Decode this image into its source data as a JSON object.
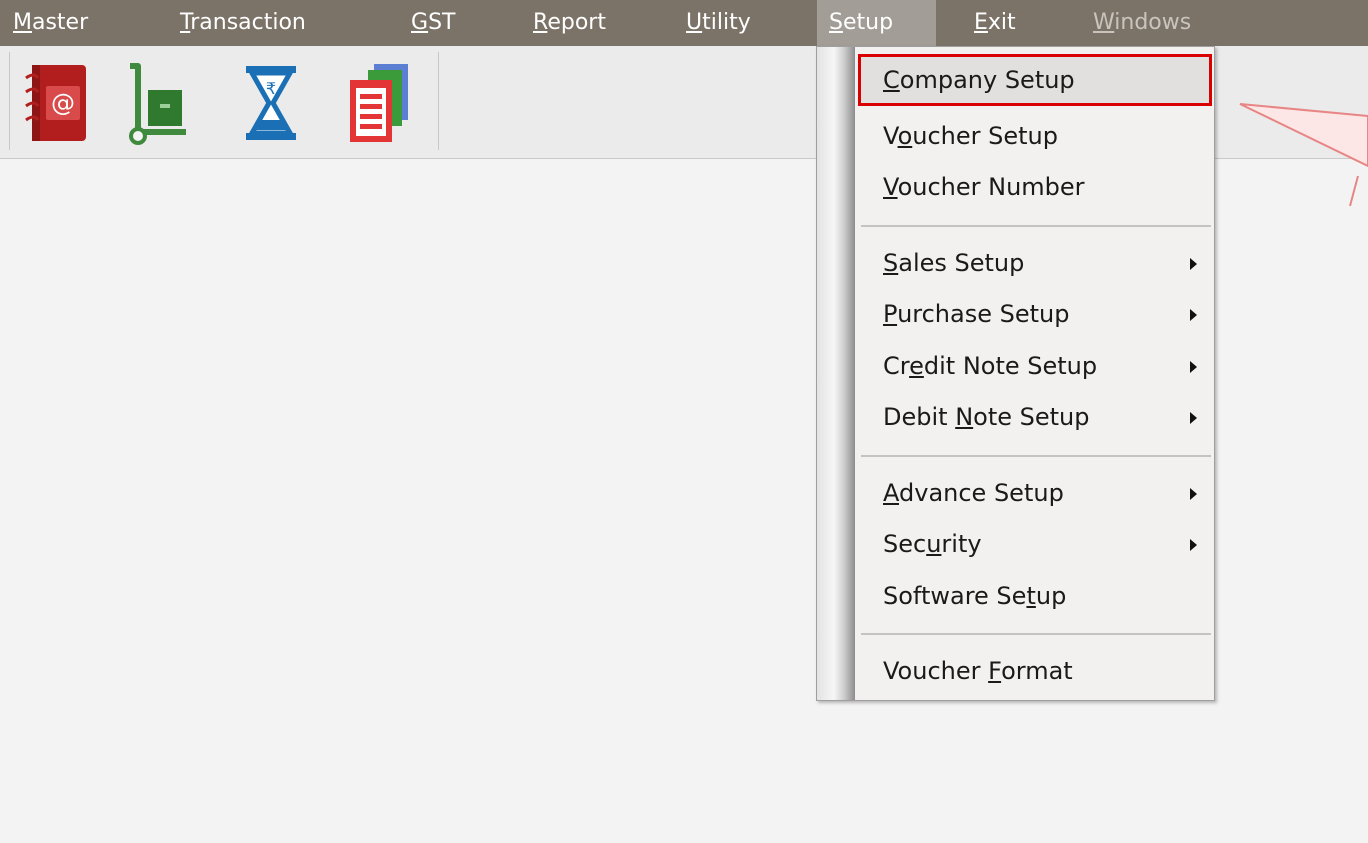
{
  "menubar": {
    "items": [
      {
        "pre": "",
        "acc": "M",
        "post": "aster"
      },
      {
        "pre": "",
        "acc": "T",
        "post": "ransaction"
      },
      {
        "pre": "",
        "acc": "G",
        "post": "ST"
      },
      {
        "pre": "",
        "acc": "R",
        "post": "eport"
      },
      {
        "pre": "",
        "acc": "U",
        "post": "tility"
      },
      {
        "pre": "",
        "acc": "S",
        "post": "etup"
      },
      {
        "pre": "",
        "acc": "E",
        "post": "xit"
      },
      {
        "pre": "",
        "acc": "W",
        "post": "indows"
      }
    ],
    "active_item": "Setup",
    "disabled_item": "Windows"
  },
  "toolbar": {
    "icons": [
      "address-book-icon",
      "hand-truck-icon",
      "hourglass-rupee-icon",
      "documents-stack-icon"
    ]
  },
  "setup_menu": {
    "items": [
      {
        "pre": "",
        "acc": "C",
        "post": "ompany Setup",
        "submenu": false,
        "highlighted": true
      },
      {
        "pre": "V",
        "acc": "o",
        "post": "ucher Setup",
        "submenu": false
      },
      {
        "pre": "",
        "acc": "V",
        "post": "oucher Number",
        "submenu": false
      },
      {
        "pre": "",
        "acc": "S",
        "post": "ales Setup",
        "submenu": true
      },
      {
        "pre": "",
        "acc": "P",
        "post": "urchase Setup",
        "submenu": true
      },
      {
        "pre": "Cr",
        "acc": "e",
        "post": "dit Note Setup",
        "submenu": true
      },
      {
        "pre": "Debit ",
        "acc": "N",
        "post": "ote Setup",
        "submenu": true
      },
      {
        "pre": "",
        "acc": "A",
        "post": "dvance Setup",
        "submenu": true
      },
      {
        "pre": "Sec",
        "acc": "u",
        "post": "rity",
        "submenu": true
      },
      {
        "pre": "Software Se",
        "acc": "t",
        "post": "up",
        "submenu": false
      },
      {
        "pre": "Voucher ",
        "acc": "F",
        "post": "ormat",
        "submenu": false
      }
    ]
  },
  "colors": {
    "menubar": "#7b7368",
    "active_menu": "#a29d96",
    "highlight_border": "#d80000",
    "callout_fill": "#fde6e6",
    "callout_stroke": "#e88585"
  }
}
